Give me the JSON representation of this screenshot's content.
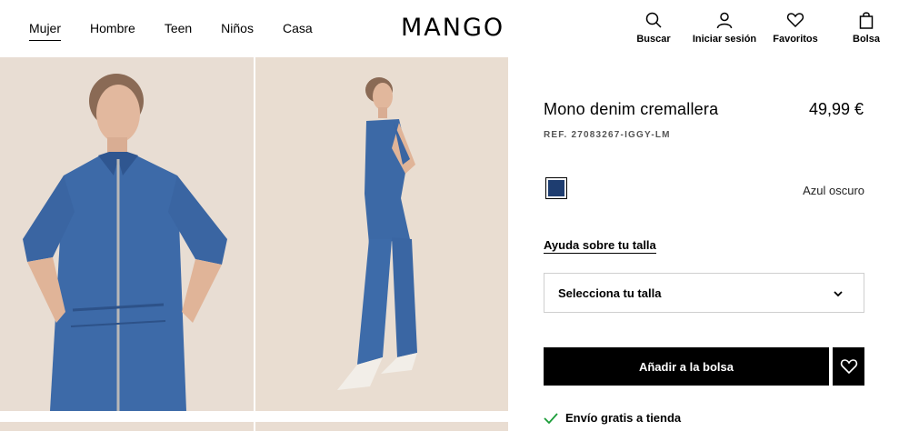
{
  "header": {
    "nav": [
      "Mujer",
      "Hombre",
      "Teen",
      "Niños",
      "Casa"
    ],
    "logo": "MANGO",
    "actions": {
      "search": "Buscar",
      "login": "Iniciar sesión",
      "favorites": "Favoritos",
      "bag": "Bolsa"
    }
  },
  "product": {
    "title": "Mono denim cremallera",
    "price": "49,99 €",
    "ref": "REF. 27083267-IGGY-LM",
    "color_name": "Azul oscuro",
    "color_hex": "#1e3d70",
    "size_help": "Ayuda sobre tu talla",
    "size_select": "Selecciona tu talla",
    "add_to_bag": "Añadir a la bolsa",
    "shipping": "Envío gratis a tienda"
  }
}
